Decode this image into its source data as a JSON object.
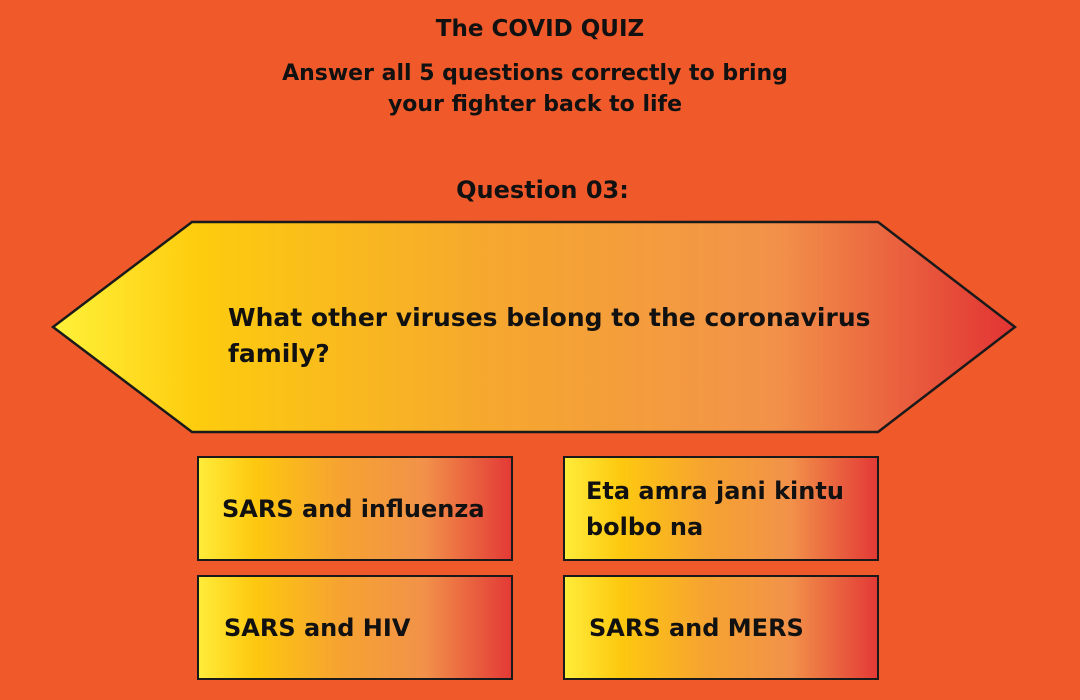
{
  "quiz": {
    "title": "The COVID QUIZ",
    "subtitle_line1": "Answer all 5 questions correctly to bring",
    "subtitle_line2": "your fighter back to life",
    "question_label": "Question 03:",
    "question_text": "What other viruses belong to the coronavirus family?"
  },
  "answers": [
    {
      "label": "SARS and influenza"
    },
    {
      "label": "Eta amra jani kintu bolbo na"
    },
    {
      "label": "SARS and HIV"
    },
    {
      "label": "SARS and MERS"
    }
  ],
  "colors": {
    "background": "#f05a2b",
    "gradient_start": "#ffec3a",
    "gradient_mid": "#fdc80f",
    "gradient_end": "#e33a36",
    "border": "#1a1a1a"
  }
}
